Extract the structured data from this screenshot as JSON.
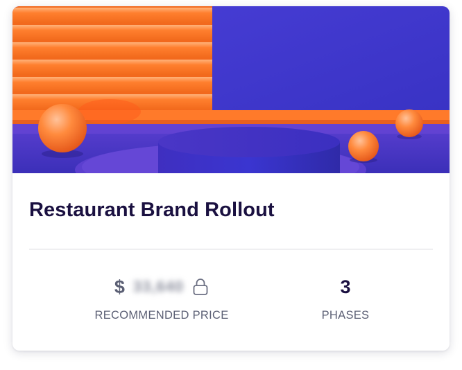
{
  "card": {
    "title": "Restaurant Brand Rollout",
    "hero_image": "abstract-3d-scene-image",
    "colors": {
      "orange": "#ff7a2a",
      "purple": "#3d36c8",
      "title_text": "#1a1040",
      "muted_text": "#5b5f74"
    }
  },
  "stats": {
    "price": {
      "currency": "$",
      "value_masked": "33,640",
      "locked": true,
      "icon": "lock-icon",
      "label": "RECOMMENDED PRICE"
    },
    "phases": {
      "value": "3",
      "label": "PHASES"
    }
  }
}
